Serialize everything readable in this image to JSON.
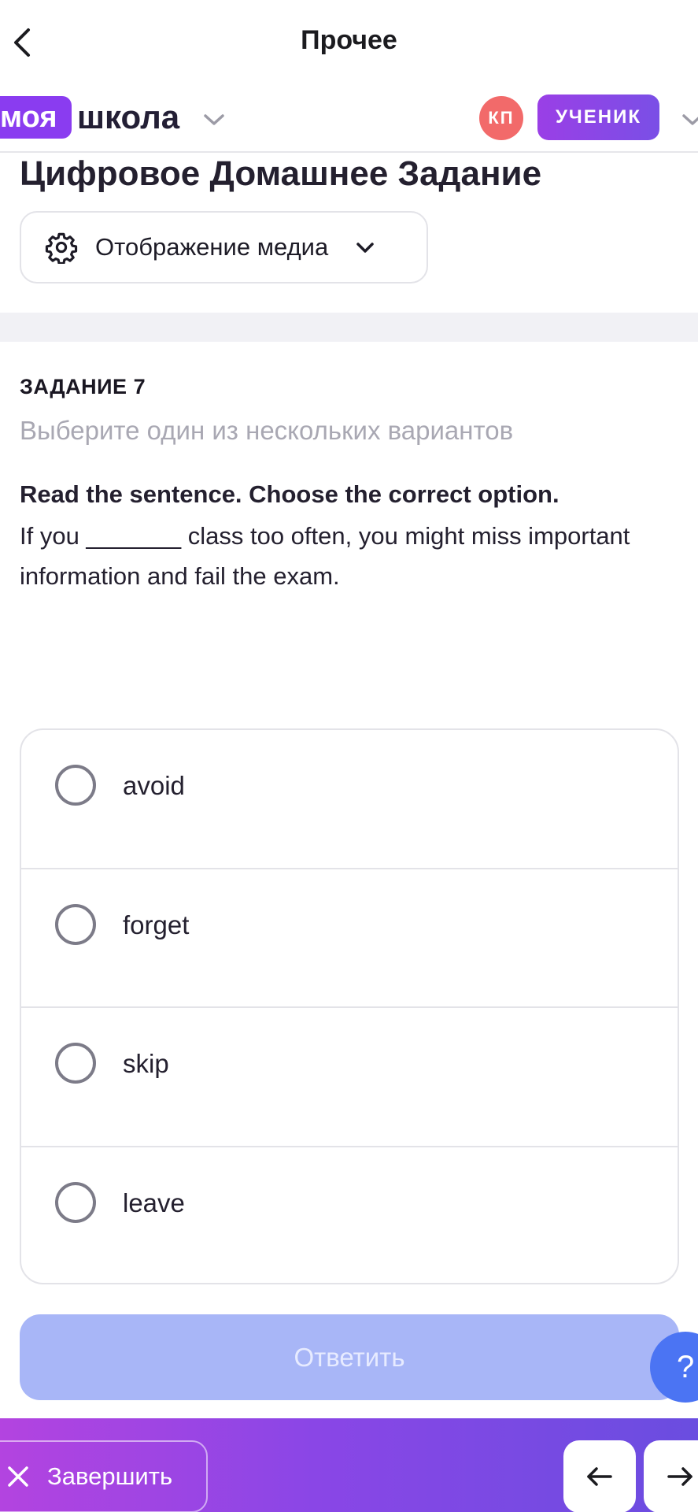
{
  "topbar": {
    "title": "Прочее"
  },
  "brand": {
    "logo_highlight": "моя",
    "logo_word": "школа",
    "avatar_initials": "КП",
    "role": "УЧЕНИК"
  },
  "page": {
    "title": "Цифровое Домашнее Задание",
    "media_dropdown": "Отображение медиа"
  },
  "task": {
    "label": "ЗАДАНИЕ 7",
    "hint": "Выберите один из нескольких вариантов",
    "instruction": "Read the sentence. Choose the correct option.",
    "sentence": "If you _______ class too often, you might miss important information and fail the exam."
  },
  "options": [
    {
      "text": "avoid"
    },
    {
      "text": "forget"
    },
    {
      "text": "skip"
    },
    {
      "text": "leave"
    }
  ],
  "answer_label": "Ответить",
  "help_label": "?",
  "footer": {
    "finish_label": "Завершить"
  },
  "colors": {
    "accent": "#8a3cf0",
    "avatar": "#f26a6a",
    "answer_disabled": "#a8b6f7",
    "help": "#4b74f3"
  }
}
